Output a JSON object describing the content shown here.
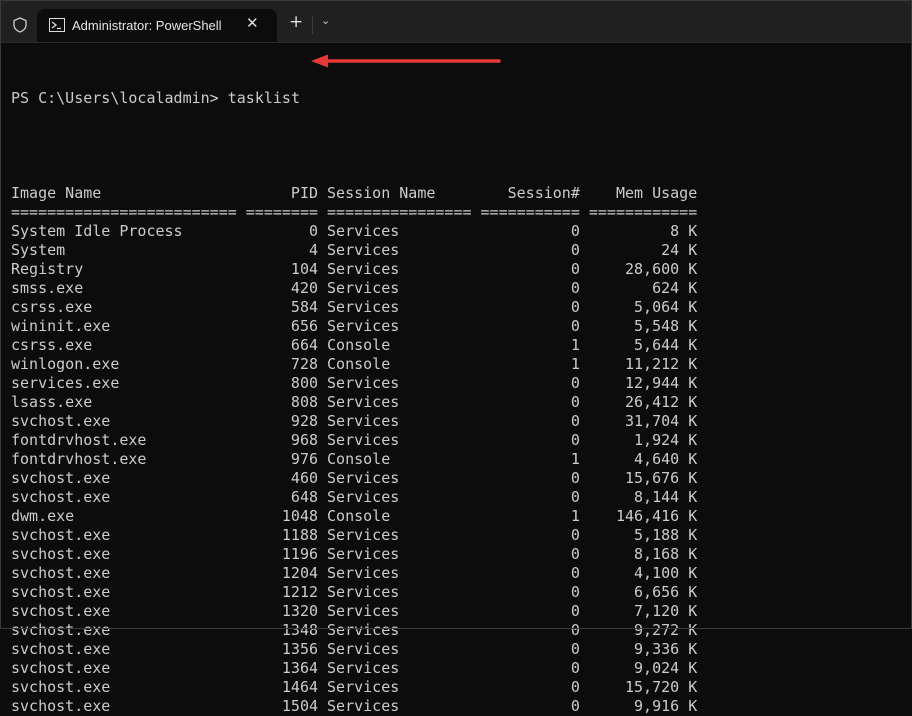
{
  "window": {
    "tab_title": "Administrator: PowerShell",
    "close_label": "✕",
    "new_tab_label": "+",
    "dropdown_label": "⌄"
  },
  "terminal": {
    "prompt": "PS C:\\Users\\localadmin> ",
    "command": "tasklist",
    "columns": [
      "Image Name",
      "PID",
      "Session Name",
      "Session#",
      "Mem Usage"
    ],
    "separators": [
      "=========================",
      "========",
      "================",
      "===========",
      "============"
    ],
    "rows": [
      [
        "System Idle Process",
        "0",
        "Services",
        "0",
        "8 K"
      ],
      [
        "System",
        "4",
        "Services",
        "0",
        "24 K"
      ],
      [
        "Registry",
        "104",
        "Services",
        "0",
        "28,600 K"
      ],
      [
        "smss.exe",
        "420",
        "Services",
        "0",
        "624 K"
      ],
      [
        "csrss.exe",
        "584",
        "Services",
        "0",
        "5,064 K"
      ],
      [
        "wininit.exe",
        "656",
        "Services",
        "0",
        "5,548 K"
      ],
      [
        "csrss.exe",
        "664",
        "Console",
        "1",
        "5,644 K"
      ],
      [
        "winlogon.exe",
        "728",
        "Console",
        "1",
        "11,212 K"
      ],
      [
        "services.exe",
        "800",
        "Services",
        "0",
        "12,944 K"
      ],
      [
        "lsass.exe",
        "808",
        "Services",
        "0",
        "26,412 K"
      ],
      [
        "svchost.exe",
        "928",
        "Services",
        "0",
        "31,704 K"
      ],
      [
        "fontdrvhost.exe",
        "968",
        "Services",
        "0",
        "1,924 K"
      ],
      [
        "fontdrvhost.exe",
        "976",
        "Console",
        "1",
        "4,640 K"
      ],
      [
        "svchost.exe",
        "460",
        "Services",
        "0",
        "15,676 K"
      ],
      [
        "svchost.exe",
        "648",
        "Services",
        "0",
        "8,144 K"
      ],
      [
        "dwm.exe",
        "1048",
        "Console",
        "1",
        "146,416 K"
      ],
      [
        "svchost.exe",
        "1188",
        "Services",
        "0",
        "5,188 K"
      ],
      [
        "svchost.exe",
        "1196",
        "Services",
        "0",
        "8,168 K"
      ],
      [
        "svchost.exe",
        "1204",
        "Services",
        "0",
        "4,100 K"
      ],
      [
        "svchost.exe",
        "1212",
        "Services",
        "0",
        "6,656 K"
      ],
      [
        "svchost.exe",
        "1320",
        "Services",
        "0",
        "7,120 K"
      ],
      [
        "svchost.exe",
        "1348",
        "Services",
        "0",
        "9,272 K"
      ],
      [
        "svchost.exe",
        "1356",
        "Services",
        "0",
        "9,336 K"
      ],
      [
        "svchost.exe",
        "1364",
        "Services",
        "0",
        "9,024 K"
      ],
      [
        "svchost.exe",
        "1464",
        "Services",
        "0",
        "15,720 K"
      ],
      [
        "svchost.exe",
        "1504",
        "Services",
        "0",
        "9,916 K"
      ]
    ]
  },
  "colors": {
    "background": "#0c0c0c",
    "text": "#cccccc",
    "arrow": "#e53935"
  }
}
